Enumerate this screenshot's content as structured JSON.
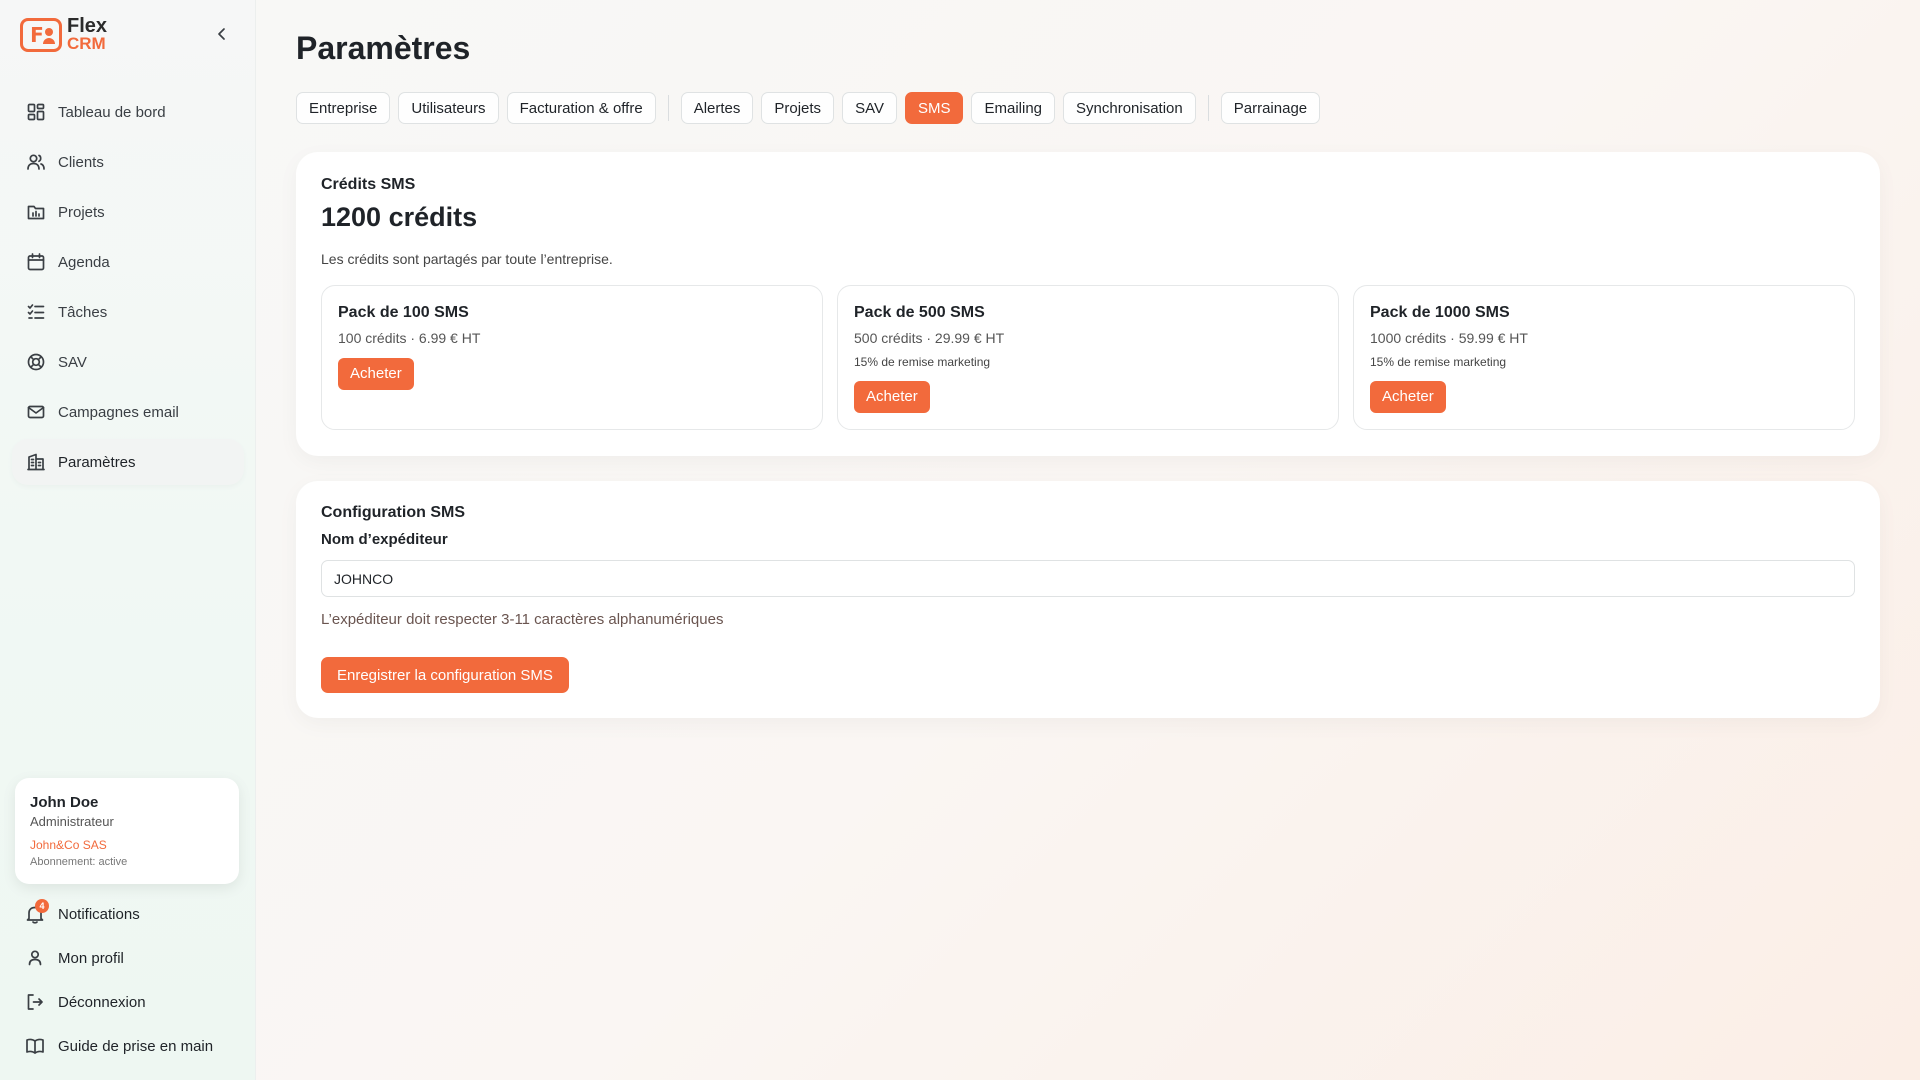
{
  "brand": {
    "name_line1": "Flex",
    "name_line2": "CRM",
    "accent": "#f26a3c"
  },
  "sidebar": {
    "items": [
      {
        "id": "dashboard",
        "label": "Tableau de bord",
        "icon": "dashboard-icon",
        "active": false
      },
      {
        "id": "clients",
        "label": "Clients",
        "icon": "users-icon",
        "active": false
      },
      {
        "id": "projets",
        "label": "Projets",
        "icon": "folder-chart-icon",
        "active": false
      },
      {
        "id": "agenda",
        "label": "Agenda",
        "icon": "calendar-icon",
        "active": false
      },
      {
        "id": "taches",
        "label": "Tâches",
        "icon": "checklist-icon",
        "active": false
      },
      {
        "id": "sav",
        "label": "SAV",
        "icon": "lifebuoy-icon",
        "active": false
      },
      {
        "id": "campagnes",
        "label": "Campagnes email",
        "icon": "mail-icon",
        "active": false
      },
      {
        "id": "parametres",
        "label": "Paramètres",
        "icon": "building-icon",
        "active": true
      }
    ],
    "user": {
      "name": "John Doe",
      "role": "Administrateur",
      "company": "John&Co SAS",
      "subscription": "Abonnement: active"
    },
    "bottom": [
      {
        "id": "notifications",
        "label": "Notifications",
        "icon": "bell-icon",
        "badge": "4"
      },
      {
        "id": "profil",
        "label": "Mon profil",
        "icon": "user-icon"
      },
      {
        "id": "deconnexion",
        "label": "Déconnexion",
        "icon": "logout-icon"
      },
      {
        "id": "guide",
        "label": "Guide de prise en main",
        "icon": "book-icon"
      }
    ]
  },
  "page": {
    "title": "Paramètres"
  },
  "tabs": [
    {
      "label": "Entreprise",
      "active": false
    },
    {
      "label": "Utilisateurs",
      "active": false
    },
    {
      "label": "Facturation & offre",
      "active": false
    },
    {
      "label": "Alertes",
      "active": false
    },
    {
      "label": "Projets",
      "active": false
    },
    {
      "label": "SAV",
      "active": false
    },
    {
      "label": "SMS",
      "active": true
    },
    {
      "label": "Emailing",
      "active": false
    },
    {
      "label": "Synchronisation",
      "active": false
    },
    {
      "label": "Parrainage",
      "active": false
    }
  ],
  "credits": {
    "title": "Crédits SMS",
    "value": "1200 crédits",
    "description": "Les crédits sont partagés par toute l’entreprise.",
    "packs": [
      {
        "title": "Pack de 100 SMS",
        "meta": "100 crédits · 6.99 € HT",
        "discount": "",
        "button": "Acheter"
      },
      {
        "title": "Pack de 500 SMS",
        "meta": "500 crédits · 29.99 € HT",
        "discount": "15% de remise marketing",
        "button": "Acheter"
      },
      {
        "title": "Pack de 1000 SMS",
        "meta": "1000 crédits · 59.99 € HT",
        "discount": "15% de remise marketing",
        "button": "Acheter"
      }
    ]
  },
  "config": {
    "title": "Configuration SMS",
    "field_label": "Nom d’expéditeur",
    "sender_value": "JOHNCO",
    "help": "L’expéditeur doit respecter 3-11 caractères alphanumériques",
    "save_label": "Enregistrer la configuration SMS"
  }
}
